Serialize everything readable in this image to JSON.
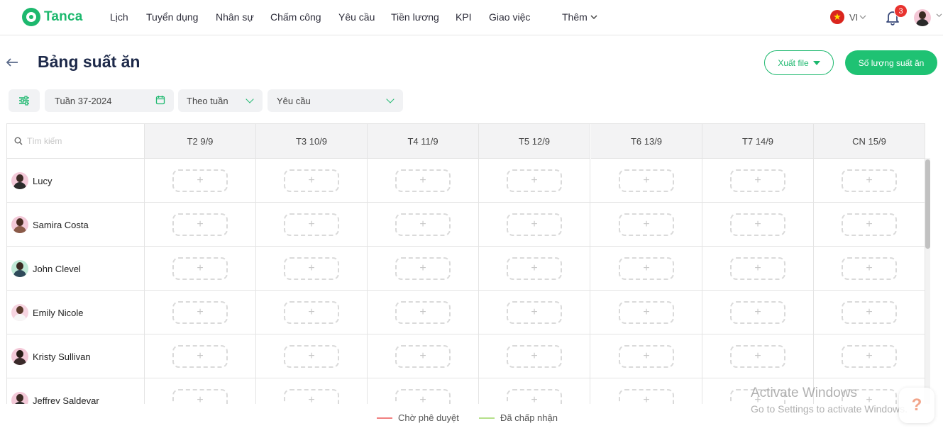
{
  "brand": {
    "name": "Tanca",
    "color": "#1db86e"
  },
  "nav": {
    "items": [
      "Lịch",
      "Tuyển dụng",
      "Nhân sự",
      "Chấm công",
      "Yêu cầu",
      "Tiền lương",
      "KPI",
      "Giao việc"
    ],
    "more_label": "Thêm",
    "language": "VI",
    "notification_count": "3"
  },
  "header": {
    "title": "Bảng suất ăn",
    "export_label": "Xuất file",
    "meals_label": "Số lượng suất ăn"
  },
  "filters": {
    "week_value": "Tuần 37-2024",
    "mode_value": "Theo tuần",
    "type_value": "Yêu cầu"
  },
  "table": {
    "search_placeholder": "Tìm kiếm",
    "days": [
      "T2 9/9",
      "T3 10/9",
      "T4 11/9",
      "T5 12/9",
      "T6 13/9",
      "T7 14/9",
      "CN 15/9"
    ],
    "add_symbol": "+",
    "employees": [
      {
        "name": "Lucy"
      },
      {
        "name": "Samira Costa"
      },
      {
        "name": "John Clevel"
      },
      {
        "name": "Emily Nicole"
      },
      {
        "name": "Kristy Sullivan"
      },
      {
        "name": "Jeffrey Saldevar"
      }
    ]
  },
  "legend": {
    "pending_label": "Chờ phê duyệt",
    "pending_color": "#f08080",
    "approved_label": "Đã chấp nhận",
    "approved_color": "#b5e08a"
  },
  "watermark": {
    "line1": "Activate Windows",
    "line2": "Go to Settings to activate Windows."
  },
  "help": {
    "symbol": "?"
  }
}
